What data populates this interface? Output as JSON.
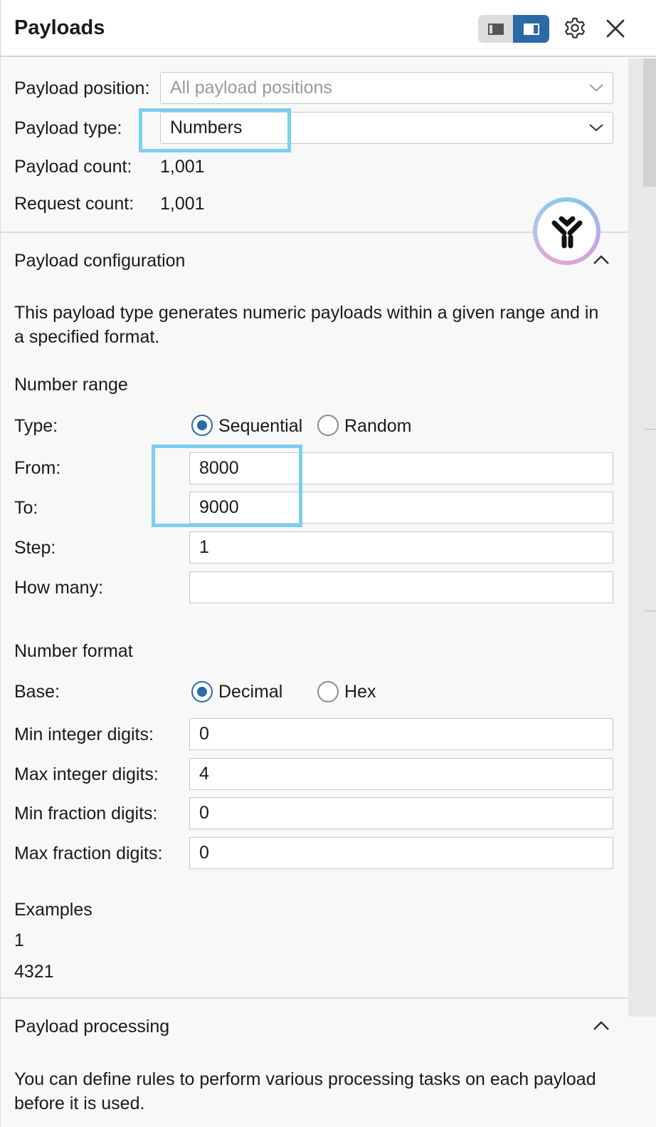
{
  "header": {
    "title": "Payloads"
  },
  "fields": {
    "position_label": "Payload position:",
    "position_value": "All payload positions",
    "type_label": "Payload type:",
    "type_value": "Numbers",
    "count_label": "Payload count:",
    "count_value": "1,001",
    "request_label": "Request count:",
    "request_value": "1,001"
  },
  "config": {
    "heading": "Payload configuration",
    "description_line1": "This payload type generates numeric payloads within a given range and in",
    "description_line2": "a specified format.",
    "range_heading": "Number range",
    "type_label": "Type:",
    "sequential_label": "Sequential",
    "random_label": "Random",
    "from_label": "From:",
    "from_value": "8000",
    "to_label": "To:",
    "to_value": "9000",
    "step_label": "Step:",
    "step_value": "1",
    "howmany_label": "How many:",
    "howmany_value": "",
    "format_heading": "Number format",
    "base_label": "Base:",
    "decimal_label": "Decimal",
    "hex_label": "Hex",
    "min_int_label": "Min integer digits:",
    "min_int_value": "0",
    "max_int_label": "Max integer digits:",
    "max_int_value": "4",
    "min_frac_label": "Min fraction digits:",
    "min_frac_value": "0",
    "max_frac_label": "Max fraction digits:",
    "max_frac_value": "0",
    "examples_heading": "Examples",
    "examples": [
      "1",
      "4321"
    ]
  },
  "processing": {
    "heading": "Payload processing",
    "description_line1": "You can define rules to perform various processing tasks on each payload",
    "description_line2": "before it is used."
  },
  "colors": {
    "accent": "#2b6aa6",
    "highlight": "#7dcfef"
  }
}
